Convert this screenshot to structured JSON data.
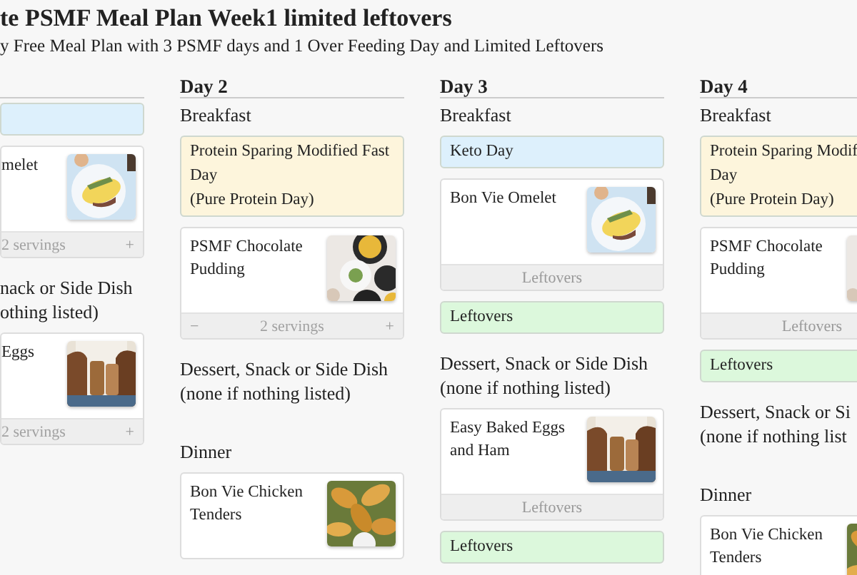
{
  "title": "te PSMF Meal Plan Week1 limited leftovers",
  "subtitle": "y Free Meal Plan with 3 PSMF days and 1 Over Feeding Day and Limited Leftovers",
  "days": [
    {
      "sections": [
        {
          "items": [
            {
              "kind": "note",
              "color": "#ddf0fc"
            },
            {
              "kind": "recipe",
              "title": [
                "melet"
              ],
              "picture": {
                "kind": "picture"
              },
              "footer": {
                "kind": "servings",
                "text": "2 servings",
                "plus": "+"
              }
            }
          ]
        },
        {
          "heading": [
            "nack or Side Dish",
            "othing listed)"
          ],
          "items": [
            {
              "kind": "recipe",
              "title": [
                "Eggs"
              ],
              "picture": {
                "kind": "picture"
              },
              "footer": {
                "kind": "servings",
                "text": "2 servings",
                "plus": "+"
              }
            }
          ]
        }
      ]
    },
    {
      "label": "Day 2",
      "sections": [
        {
          "heading": [
            "Breakfast"
          ],
          "items": [
            {
              "kind": "note",
              "color": "#fdf5dc",
              "lines": [
                "Protein Sparing Modified Fast",
                "Day",
                "(Pure Protein Day)"
              ]
            },
            {
              "kind": "recipe",
              "title": [
                "PSMF Chocolate",
                "Pudding"
              ],
              "picture": {
                "kind": "picture"
              },
              "footer": {
                "kind": "servings",
                "minus": "−",
                "text": "2 servings",
                "plus": "+"
              }
            }
          ]
        },
        {
          "heading": [
            "Dessert, Snack or Side Dish",
            "(none if nothing listed)"
          ]
        },
        {
          "heading": [
            "Dinner"
          ],
          "items": [
            {
              "kind": "recipe",
              "title": [
                "Bon Vie Chicken",
                "Tenders"
              ],
              "picture": {
                "kind": "picture"
              }
            }
          ]
        }
      ]
    },
    {
      "label": "Day 3",
      "sections": [
        {
          "heading": [
            "Breakfast"
          ],
          "items": [
            {
              "kind": "note",
              "color": "#ddf0fc",
              "lines": [
                "Keto Day"
              ]
            },
            {
              "kind": "recipe",
              "title": [
                "Bon Vie Omelet"
              ],
              "picture": {
                "kind": "picture"
              },
              "footer": {
                "kind": "leftovers",
                "text": "Leftovers"
              }
            },
            {
              "kind": "note",
              "color": "#dcf8dc",
              "lines": [
                "Leftovers"
              ]
            }
          ]
        },
        {
          "heading": [
            "Dessert, Snack or Side Dish",
            "(none if nothing listed)"
          ],
          "items": [
            {
              "kind": "recipe",
              "title": [
                "Easy Baked Eggs",
                "and Ham"
              ],
              "picture": {
                "kind": "picture"
              },
              "footer": {
                "kind": "leftovers",
                "text": "Leftovers"
              }
            },
            {
              "kind": "note",
              "color": "#dcf8dc",
              "lines": [
                "Leftovers"
              ]
            }
          ]
        }
      ]
    },
    {
      "label": "Day 4",
      "sections": [
        {
          "heading": [
            "Breakfast"
          ],
          "items": [
            {
              "kind": "note",
              "color": "#fdf5dc",
              "lines": [
                "Protein Sparing Modif",
                "Day",
                "(Pure Protein Day)"
              ]
            },
            {
              "kind": "recipe",
              "title": [
                "PSMF Chocolate",
                "Pudding"
              ],
              "picture": {
                "kind": "picture"
              },
              "footer": {
                "kind": "leftovers",
                "text": "Leftovers"
              }
            },
            {
              "kind": "note",
              "color": "#dcf8dc",
              "lines": [
                "Leftovers"
              ]
            }
          ]
        },
        {
          "heading": [
            "Dessert, Snack or Si",
            "(none if nothing list"
          ]
        },
        {
          "heading": [
            "Dinner"
          ],
          "items": [
            {
              "kind": "recipe",
              "title": [
                "Bon Vie Chicken",
                "Tenders"
              ],
              "picture": {
                "kind": "picture"
              }
            }
          ]
        }
      ]
    }
  ]
}
